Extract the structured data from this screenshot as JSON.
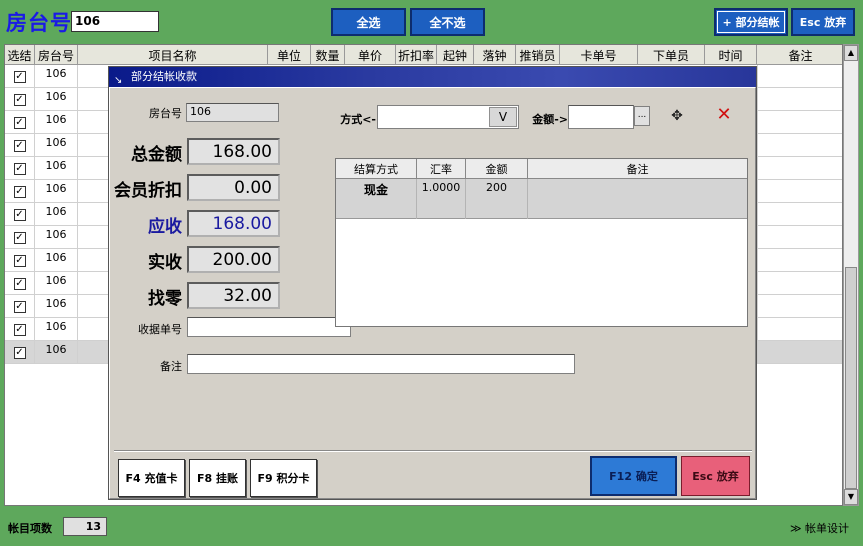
{
  "topbar": {
    "room_label": "房台号",
    "room_value": "106",
    "select_all": "全选",
    "select_none": "全不选",
    "partial_checkout": "+ 部分结帐",
    "esc_cancel": "Esc 放弃"
  },
  "grid": {
    "headers": [
      "选结",
      "房台号",
      "项目名称",
      "单位",
      "数量",
      "单价",
      "折扣率",
      "起钟",
      "落钟",
      "推销员",
      "卡单号",
      "下单员",
      "时间",
      "备注"
    ],
    "rows": [
      {
        "checked": "✓",
        "room": "106"
      },
      {
        "checked": "✓",
        "room": "106"
      },
      {
        "checked": "✓",
        "room": "106"
      },
      {
        "checked": "✓",
        "room": "106"
      },
      {
        "checked": "✓",
        "room": "106"
      },
      {
        "checked": "✓",
        "room": "106"
      },
      {
        "checked": "✓",
        "room": "106"
      },
      {
        "checked": "✓",
        "room": "106"
      },
      {
        "checked": "✓",
        "room": "106"
      },
      {
        "checked": "✓",
        "room": "106"
      },
      {
        "checked": "✓",
        "room": "106"
      },
      {
        "checked": "✓",
        "room": "106"
      },
      {
        "checked": "✓",
        "room": "106"
      }
    ]
  },
  "scrollbar": {
    "up": "▲",
    "down": "▼"
  },
  "dialog": {
    "title": "部分结帐收款",
    "title_icon": "↘",
    "room_label": "房台号",
    "room_value": "106",
    "total_label": "总金额",
    "total_value": "168.00",
    "discount_label": "会员折扣",
    "discount_value": "0.00",
    "receivable_label": "应收",
    "receivable_value": "168.00",
    "received_label": "实收",
    "received_value": "200.00",
    "change_label": "找零",
    "change_value": "32.00",
    "receipt_label": "收据单号",
    "receipt_value": "",
    "note_label": "备注",
    "note_value": "",
    "method_label": "方式<-",
    "method_value": "",
    "method_drop": "V",
    "amount_label": "金额->",
    "amount_value": "",
    "ellipsis": "...",
    "add_icon": "✥",
    "delete_icon": "✕",
    "pay_grid": {
      "headers": [
        "结算方式",
        "汇率",
        "金额",
        "备注"
      ],
      "rows": [
        {
          "method": "现金",
          "rate": "1.0000",
          "amount": "200",
          "note": ""
        }
      ]
    },
    "btn_f4": "F4 充值卡",
    "btn_f8": "F8 挂账",
    "btn_f9": "F9 积分卡",
    "btn_ok": "F12 确定",
    "btn_cancel": "Esc 放弃"
  },
  "bottombar": {
    "count_label": "帐目项数",
    "count_value": "13",
    "design_link": "≫ 帐单设计"
  },
  "colors": {
    "background": "#5ea85c",
    "accent_blue": "#1d5fc0",
    "title_blue": "#1a1ae6",
    "ok_blue": "#2d7ad6",
    "cancel_red": "#e8607a",
    "delete_red": "#d01010"
  }
}
